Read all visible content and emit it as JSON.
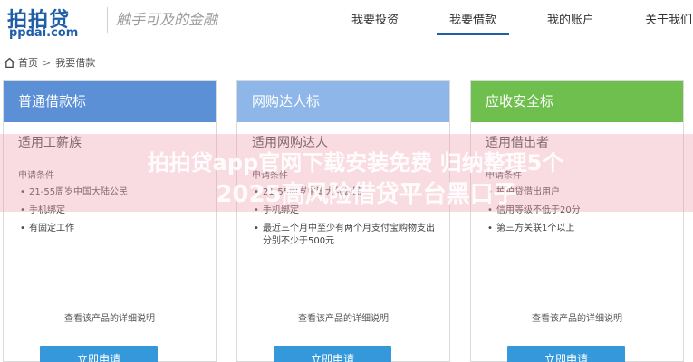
{
  "header": {
    "logo_main": "拍拍贷",
    "logo_sub": "ppdai.com",
    "slogan": "触手可及的金融",
    "nav": [
      {
        "label": "我要投资",
        "active": false
      },
      {
        "label": "我要借款",
        "active": true
      },
      {
        "label": "我的账户",
        "active": false
      },
      {
        "label": "关于我们",
        "active": false
      }
    ]
  },
  "breadcrumb": {
    "home": "首页",
    "separator": ">",
    "current": "我要借款"
  },
  "cards": [
    {
      "title": "普通借款标",
      "header_color": "#5b8fd6",
      "subtitle": "适用工薪族",
      "section_label": "申请条件",
      "items": [
        "21-55周岁中国大陆公民",
        "手机绑定",
        "有固定工作"
      ],
      "detail_link": "查看该产品的详细说明",
      "apply_label": "立即申请"
    },
    {
      "title": "网购达人标",
      "header_color": "#8fb6e8",
      "subtitle": "适用网购达人",
      "section_label": "申请条件",
      "items": [
        "21-55周岁中国大陆公民",
        "手机绑定",
        "最近三个月中至少有两个月支付宝购物支出分别不少于500元"
      ],
      "detail_link": "查看该产品的详细说明",
      "apply_label": "立即申请"
    },
    {
      "title": "应收安全标",
      "header_color": "#6fbf4e",
      "subtitle": "适用借出者",
      "section_label": "申请条件",
      "items": [
        "拍拍贷借出用户",
        "信用等级不低于20分",
        "第三方关联1个以上"
      ],
      "detail_link": "查看该产品的详细说明",
      "apply_label": "立即申请"
    }
  ],
  "watermark": {
    "line1": "拍拍贷app官网下载安装免费 归纳整理5个",
    "line2": "2025高风险借贷平台黑口子"
  }
}
